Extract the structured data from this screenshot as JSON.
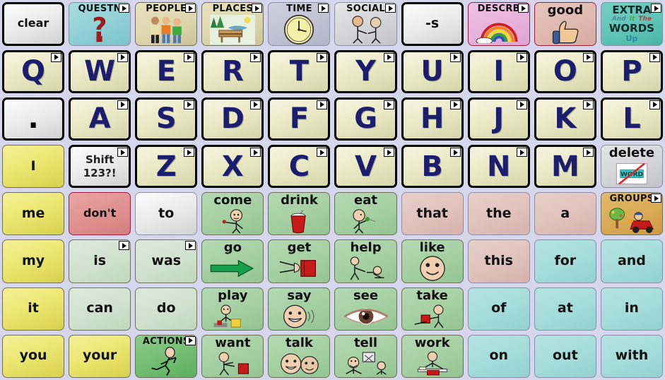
{
  "app": {
    "name": "AAC Communication Board",
    "background_color": "#d6d6ec",
    "grid": {
      "columns": 10,
      "rows": 8
    }
  },
  "colors": {
    "letter_key_text": "#1d1d70",
    "word_text": "#111111",
    "board_background": "#d6d6ec",
    "pronoun_yellow": "#ece772",
    "verb_green": "#a4cfa2",
    "preposition_cyan": "#a4dcda",
    "determiner_rose": "#e0c2bb",
    "category_gold": "#d9ab55",
    "negation_red": "#de908f"
  },
  "rows": [
    {
      "name": "row-categories",
      "keys": [
        {
          "label": "clear",
          "style": "g-white",
          "border": "bd-thick",
          "type": "command",
          "arrow": false,
          "icon": null
        },
        {
          "label": "QUESTN",
          "style": "g-teal",
          "border": "bd-thin-gray",
          "type": "category",
          "arrow": true,
          "icon": "question-mark-icon"
        },
        {
          "label": "PEOPLE",
          "style": "g-tan",
          "border": "bd-thin-olive",
          "type": "category",
          "arrow": true,
          "icon": "three-people-icon"
        },
        {
          "label": "PLACES",
          "style": "g-tan",
          "border": "bd-thin-olive",
          "type": "category",
          "arrow": true,
          "icon": "park-bench-icon"
        },
        {
          "label": "TIME",
          "style": "g-lav",
          "border": "bd-thin-gray",
          "type": "category",
          "arrow": true,
          "icon": "clock-icon"
        },
        {
          "label": "SOCIAL",
          "style": "g-silver",
          "border": "bd-thin-gray",
          "type": "category",
          "arrow": true,
          "icon": "two-people-greeting-icon"
        },
        {
          "label": "-s",
          "style": "g-white",
          "border": "bd-thick",
          "type": "morpheme",
          "arrow": false,
          "icon": null
        },
        {
          "label": "DESCRB",
          "style": "g-pink",
          "border": "bd-thin-red",
          "type": "category",
          "arrow": true,
          "icon": "rainbow-icon"
        },
        {
          "label": "good",
          "style": "g-salmon",
          "border": "bd-thin-red",
          "type": "word",
          "arrow": false,
          "icon": "thumbs-up-icon"
        },
        {
          "label": "EXTRA",
          "style": "g-turq",
          "border": "bd-thin-gray",
          "type": "category",
          "arrow": true,
          "icon": "extra-words-icon",
          "extra": {
            "line2": [
              "And",
              "It",
              "The"
            ],
            "line3": "WORDS",
            "line4": "Up"
          }
        }
      ]
    },
    {
      "name": "row-letters-qwerty",
      "keys": [
        {
          "label": "Q",
          "style": "g-letter",
          "border": "bd-thick",
          "type": "letter",
          "arrow": true,
          "icon": null
        },
        {
          "label": "W",
          "style": "g-letter",
          "border": "bd-thick",
          "type": "letter",
          "arrow": true,
          "icon": null
        },
        {
          "label": "E",
          "style": "g-letter",
          "border": "bd-thick",
          "type": "letter",
          "arrow": true,
          "icon": null
        },
        {
          "label": "R",
          "style": "g-letter",
          "border": "bd-thick",
          "type": "letter",
          "arrow": true,
          "icon": null
        },
        {
          "label": "T",
          "style": "g-letter",
          "border": "bd-thick",
          "type": "letter",
          "arrow": true,
          "icon": null
        },
        {
          "label": "Y",
          "style": "g-letter",
          "border": "bd-thick",
          "type": "letter",
          "arrow": true,
          "icon": null
        },
        {
          "label": "U",
          "style": "g-letter",
          "border": "bd-thick",
          "type": "letter",
          "arrow": true,
          "icon": null
        },
        {
          "label": "I",
          "style": "g-letter",
          "border": "bd-thick",
          "type": "letter",
          "arrow": true,
          "icon": null
        },
        {
          "label": "O",
          "style": "g-letter",
          "border": "bd-thick",
          "type": "letter",
          "arrow": true,
          "icon": null
        },
        {
          "label": "P",
          "style": "g-letter",
          "border": "bd-thick",
          "type": "letter",
          "arrow": true,
          "icon": null
        }
      ]
    },
    {
      "name": "row-letters-asdf",
      "keys": [
        {
          "label": ".",
          "style": "g-white",
          "border": "bd-thick",
          "type": "punctuation",
          "arrow": false,
          "icon": null
        },
        {
          "label": "A",
          "style": "g-letter",
          "border": "bd-thick",
          "type": "letter",
          "arrow": true,
          "icon": null
        },
        {
          "label": "S",
          "style": "g-letter",
          "border": "bd-thick",
          "type": "letter",
          "arrow": true,
          "icon": null
        },
        {
          "label": "D",
          "style": "g-letter",
          "border": "bd-thick",
          "type": "letter",
          "arrow": true,
          "icon": null
        },
        {
          "label": "F",
          "style": "g-letter",
          "border": "bd-thick",
          "type": "letter",
          "arrow": true,
          "icon": null
        },
        {
          "label": "G",
          "style": "g-letter",
          "border": "bd-thick",
          "type": "letter",
          "arrow": true,
          "icon": null
        },
        {
          "label": "H",
          "style": "g-letter",
          "border": "bd-thick",
          "type": "letter",
          "arrow": true,
          "icon": null
        },
        {
          "label": "J",
          "style": "g-letter",
          "border": "bd-thick",
          "type": "letter",
          "arrow": true,
          "icon": null
        },
        {
          "label": "K",
          "style": "g-letter",
          "border": "bd-thick",
          "type": "letter",
          "arrow": true,
          "icon": null
        },
        {
          "label": "L",
          "style": "g-letter",
          "border": "bd-thick",
          "type": "letter",
          "arrow": true,
          "icon": null
        }
      ]
    },
    {
      "name": "row-letters-zxcv",
      "keys": [
        {
          "label": "I",
          "style": "g-yellow",
          "border": "bd-thin-olive",
          "type": "pronoun",
          "arrow": false,
          "icon": null
        },
        {
          "label": "Shift 123?!",
          "style": "g-white",
          "border": "bd-thick",
          "type": "command",
          "arrow": true,
          "icon": null,
          "lines": [
            "Shift",
            "123?!"
          ]
        },
        {
          "label": "Z",
          "style": "g-letter",
          "border": "bd-thick",
          "type": "letter",
          "arrow": true,
          "icon": null
        },
        {
          "label": "X",
          "style": "g-letter",
          "border": "bd-thick",
          "type": "letter",
          "arrow": true,
          "icon": null
        },
        {
          "label": "C",
          "style": "g-letter",
          "border": "bd-thick",
          "type": "letter",
          "arrow": true,
          "icon": null
        },
        {
          "label": "V",
          "style": "g-letter",
          "border": "bd-thick",
          "type": "letter",
          "arrow": true,
          "icon": null
        },
        {
          "label": "B",
          "style": "g-letter",
          "border": "bd-thick",
          "type": "letter",
          "arrow": true,
          "icon": null
        },
        {
          "label": "N",
          "style": "g-letter",
          "border": "bd-thick",
          "type": "letter",
          "arrow": true,
          "icon": null
        },
        {
          "label": "M",
          "style": "g-letter",
          "border": "bd-thick",
          "type": "letter",
          "arrow": true,
          "icon": null
        },
        {
          "label": "delete",
          "style": "g-silver",
          "border": "bd-thin-gray",
          "type": "command",
          "arrow": false,
          "icon": "delete-word-icon"
        }
      ]
    },
    {
      "name": "row-words-1",
      "keys": [
        {
          "label": "me",
          "style": "g-yellow",
          "border": "bd-thin-olive",
          "type": "pronoun",
          "arrow": false,
          "icon": null
        },
        {
          "label": "don't",
          "style": "g-red",
          "border": "bd-thin-red",
          "type": "negation",
          "arrow": false,
          "icon": null
        },
        {
          "label": "to",
          "style": "g-white",
          "border": "bd-thin-gray",
          "type": "preposition",
          "arrow": false,
          "icon": null
        },
        {
          "label": "come",
          "style": "g-green",
          "border": "bd-thin-olive",
          "type": "verb",
          "arrow": false,
          "icon": "come-person-icon"
        },
        {
          "label": "drink",
          "style": "g-green",
          "border": "bd-thin-olive",
          "type": "verb",
          "arrow": false,
          "icon": "drink-cup-icon"
        },
        {
          "label": "eat",
          "style": "g-green",
          "border": "bd-thin-olive",
          "type": "verb",
          "arrow": false,
          "icon": "eat-person-icon"
        },
        {
          "label": "that",
          "style": "g-rose",
          "border": "bd-thin-gray",
          "type": "determiner",
          "arrow": false,
          "icon": null
        },
        {
          "label": "the",
          "style": "g-rose",
          "border": "bd-thin-gray",
          "type": "determiner",
          "arrow": false,
          "icon": null
        },
        {
          "label": "a",
          "style": "g-rose",
          "border": "bd-thin-gray",
          "type": "determiner",
          "arrow": false,
          "icon": null
        },
        {
          "label": "GROUPS",
          "style": "g-gold",
          "border": "bd-thin-olive",
          "type": "category",
          "arrow": true,
          "icon": "groups-playground-icon"
        }
      ]
    },
    {
      "name": "row-words-2",
      "keys": [
        {
          "label": "my",
          "style": "g-yellow",
          "border": "bd-thin-olive",
          "type": "pronoun",
          "arrow": false,
          "icon": null
        },
        {
          "label": "is",
          "style": "g-lgreen",
          "border": "bd-thin-olive",
          "type": "verb",
          "arrow": true,
          "icon": null
        },
        {
          "label": "was",
          "style": "g-lgreen",
          "border": "bd-thin-olive",
          "type": "verb",
          "arrow": true,
          "icon": null
        },
        {
          "label": "go",
          "style": "g-green",
          "border": "bd-thin-olive",
          "type": "verb",
          "arrow": false,
          "icon": "green-arrow-icon"
        },
        {
          "label": "get",
          "style": "g-green",
          "border": "bd-thin-olive",
          "type": "verb",
          "arrow": false,
          "icon": "get-hands-book-icon"
        },
        {
          "label": "help",
          "style": "g-green",
          "border": "bd-thin-olive",
          "type": "verb",
          "arrow": false,
          "icon": "help-person-icon"
        },
        {
          "label": "like",
          "style": "g-green",
          "border": "bd-thin-olive",
          "type": "verb",
          "arrow": false,
          "icon": "smiley-face-icon"
        },
        {
          "label": "this",
          "style": "g-rose",
          "border": "bd-thin-gray",
          "type": "determiner",
          "arrow": false,
          "icon": null
        },
        {
          "label": "for",
          "style": "g-cyan",
          "border": "bd-thin-gray",
          "type": "preposition",
          "arrow": false,
          "icon": null
        },
        {
          "label": "and",
          "style": "g-cyan",
          "border": "bd-thin-gray",
          "type": "conjunction",
          "arrow": false,
          "icon": null
        }
      ]
    },
    {
      "name": "row-words-3",
      "keys": [
        {
          "label": "it",
          "style": "g-yellow",
          "border": "bd-thin-olive",
          "type": "pronoun",
          "arrow": false,
          "icon": null
        },
        {
          "label": "can",
          "style": "g-lgreen",
          "border": "bd-thin-olive",
          "type": "verb",
          "arrow": false,
          "icon": null
        },
        {
          "label": "do",
          "style": "g-lgreen",
          "border": "bd-thin-olive",
          "type": "verb",
          "arrow": false,
          "icon": null
        },
        {
          "label": "play",
          "style": "g-green",
          "border": "bd-thin-olive",
          "type": "verb",
          "arrow": false,
          "icon": "play-blocks-icon"
        },
        {
          "label": "say",
          "style": "g-green",
          "border": "bd-thin-olive",
          "type": "verb",
          "arrow": false,
          "icon": "say-talking-face-icon"
        },
        {
          "label": "see",
          "style": "g-green",
          "border": "bd-thin-olive",
          "type": "verb",
          "arrow": false,
          "icon": "eye-icon"
        },
        {
          "label": "take",
          "style": "g-green",
          "border": "bd-thin-olive",
          "type": "verb",
          "arrow": false,
          "icon": "take-person-cup-icon"
        },
        {
          "label": "of",
          "style": "g-cyan",
          "border": "bd-thin-gray",
          "type": "preposition",
          "arrow": false,
          "icon": null
        },
        {
          "label": "at",
          "style": "g-cyan",
          "border": "bd-thin-gray",
          "type": "preposition",
          "arrow": false,
          "icon": null
        },
        {
          "label": "in",
          "style": "g-cyan",
          "border": "bd-thin-gray",
          "type": "preposition",
          "arrow": false,
          "icon": null
        }
      ]
    },
    {
      "name": "row-words-4",
      "keys": [
        {
          "label": "you",
          "style": "g-yellow",
          "border": "bd-thin-olive",
          "type": "pronoun",
          "arrow": false,
          "icon": null
        },
        {
          "label": "your",
          "style": "g-yellow",
          "border": "bd-thin-olive",
          "type": "pronoun",
          "arrow": false,
          "icon": null
        },
        {
          "label": "ACTIONS",
          "style": "g-dgreen",
          "border": "bd-thin-olive",
          "type": "category",
          "arrow": true,
          "icon": "running-person-icon"
        },
        {
          "label": "want",
          "style": "g-green",
          "border": "bd-thin-olive",
          "type": "verb",
          "arrow": false,
          "icon": "want-person-block-icon"
        },
        {
          "label": "talk",
          "style": "g-green",
          "border": "bd-thin-olive",
          "type": "verb",
          "arrow": false,
          "icon": "talk-two-faces-icon"
        },
        {
          "label": "tell",
          "style": "g-green",
          "border": "bd-thin-olive",
          "type": "verb",
          "arrow": false,
          "icon": "tell-person-icon"
        },
        {
          "label": "work",
          "style": "g-green",
          "border": "bd-thin-olive",
          "type": "verb",
          "arrow": false,
          "icon": "work-desk-icon"
        },
        {
          "label": "on",
          "style": "g-cyan",
          "border": "bd-thin-gray",
          "type": "preposition",
          "arrow": false,
          "icon": null
        },
        {
          "label": "out",
          "style": "g-cyan",
          "border": "bd-thin-gray",
          "type": "preposition",
          "arrow": false,
          "icon": null
        },
        {
          "label": "with",
          "style": "g-cyan",
          "border": "bd-thin-gray",
          "type": "preposition",
          "arrow": false,
          "icon": null
        }
      ]
    }
  ]
}
